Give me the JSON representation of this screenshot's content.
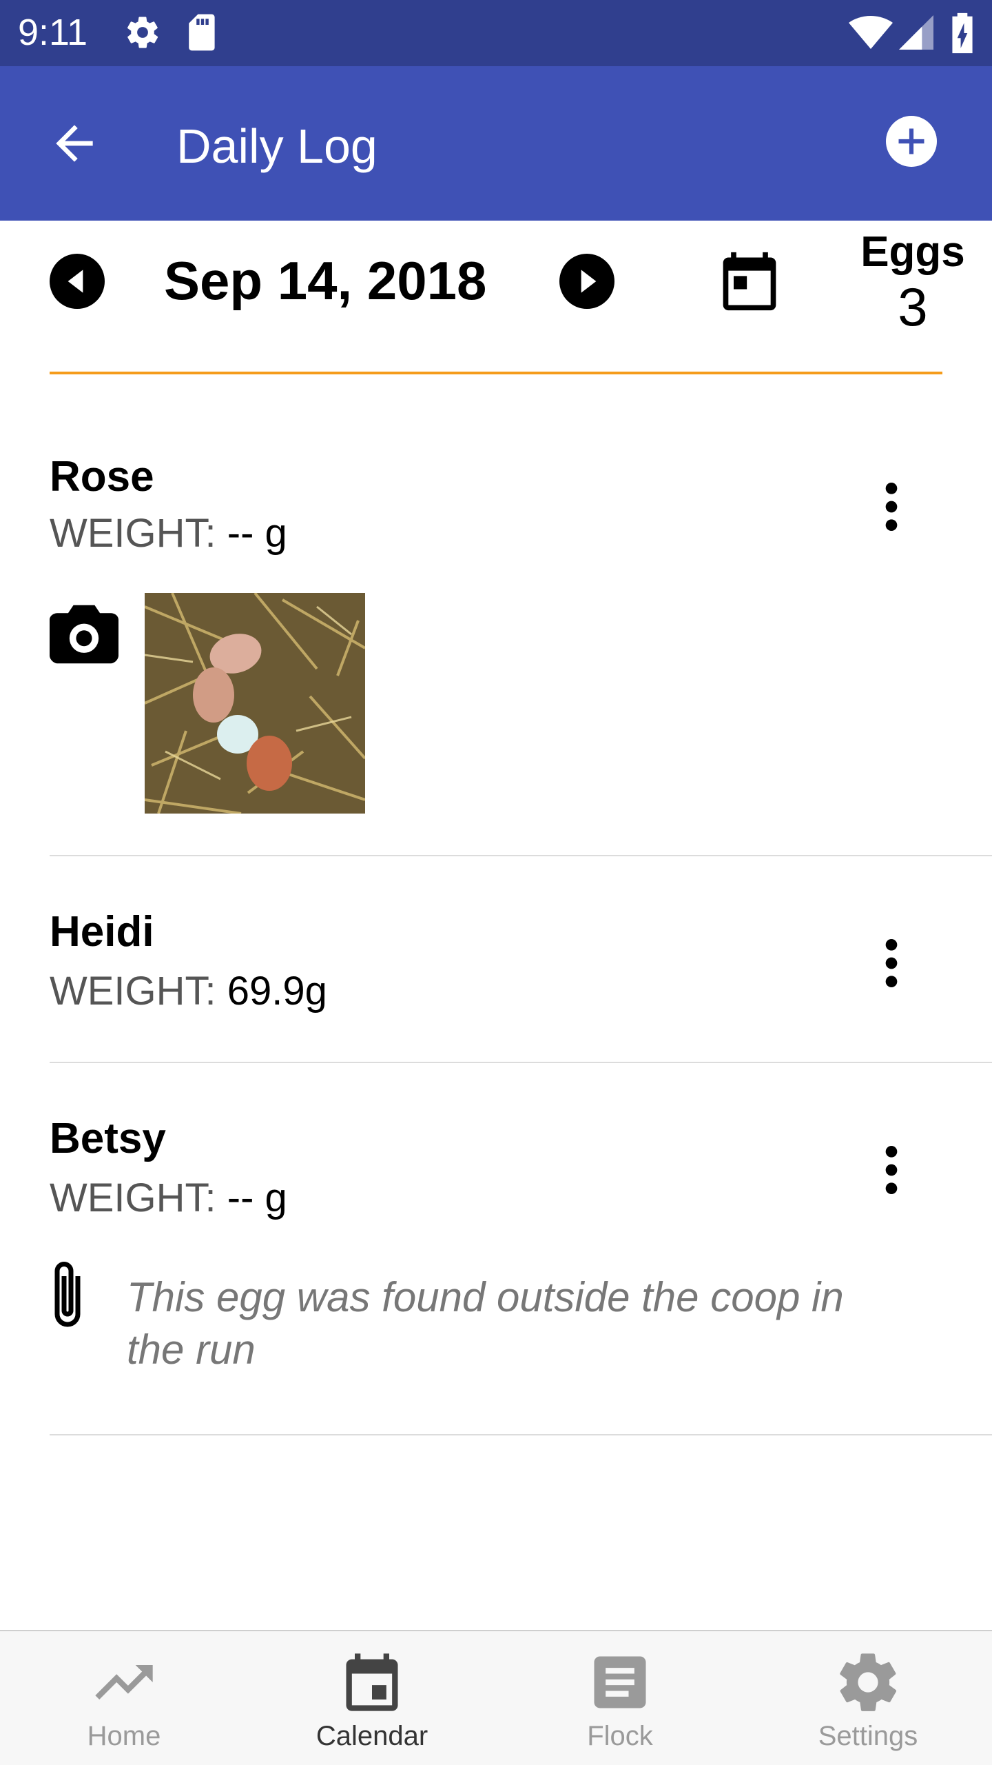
{
  "status_bar": {
    "time": "9:11"
  },
  "app_bar": {
    "title": "Daily Log"
  },
  "date_nav": {
    "date": "Sep 14, 2018",
    "eggs_label": "Eggs",
    "eggs_count": "3"
  },
  "entries": [
    {
      "name": "Rose",
      "weight_label": "WEIGHT:",
      "weight_value": "-- g",
      "has_photo": true
    },
    {
      "name": "Heidi",
      "weight_label": "WEIGHT:",
      "weight_value": "69.9g"
    },
    {
      "name": "Betsy",
      "weight_label": "WEIGHT:",
      "weight_value": "-- g",
      "note": "This egg was found outside the coop in the run"
    }
  ],
  "bottom_nav": {
    "items": [
      {
        "label": "Home",
        "icon": "trending-up-icon",
        "active": false
      },
      {
        "label": "Calendar",
        "icon": "calendar-icon",
        "active": true
      },
      {
        "label": "Flock",
        "icon": "document-icon",
        "active": false
      },
      {
        "label": "Settings",
        "icon": "gear-icon",
        "active": false
      }
    ]
  },
  "colors": {
    "status_bar": "#303f8e",
    "app_bar": "#3f51b5",
    "accent_line": "#f59c1c",
    "nav_background": "#f7f7f7"
  }
}
